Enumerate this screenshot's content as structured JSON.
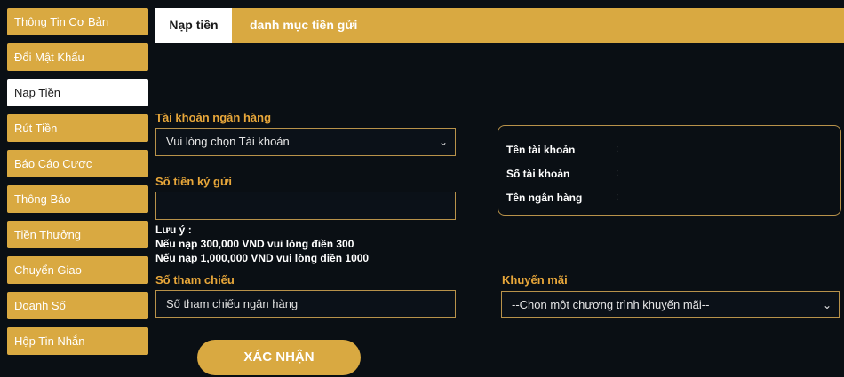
{
  "sidebar": {
    "items": [
      {
        "label": "Thông Tin Cơ Bản"
      },
      {
        "label": "Đổi Mật Khẩu"
      },
      {
        "label": "Nạp Tiền"
      },
      {
        "label": "Rút Tiền"
      },
      {
        "label": "Báo Cáo Cược"
      },
      {
        "label": "Thông Báo"
      },
      {
        "label": "Tiền Thưởng"
      },
      {
        "label": "Chuyển Giao"
      },
      {
        "label": "Doanh Số"
      },
      {
        "label": "Hộp Tin Nhắn"
      }
    ],
    "active_index": 2
  },
  "tabs": [
    {
      "label": "Nạp tiền"
    },
    {
      "label": "danh mục tiền gửi"
    }
  ],
  "form": {
    "bank_account_label": "Tài khoản ngân hàng",
    "bank_account_value": "Vui lòng chọn Tài khoản",
    "deposit_amount_label": "Số tiền ký gửi",
    "deposit_amount_value": "",
    "note_title": "Lưu ý :",
    "note_line1": "Nếu nạp 300,000 VND vui lòng điền 300",
    "note_line2": "Nếu nạp 1,000,000 VND vui lòng điền 1000",
    "reference_label": "Số tham chiếu",
    "reference_placeholder": "Số tham chiếu ngân hàng",
    "promo_label": "Khuyến mãi",
    "promo_value": "--Chọn một chương trình khuyến mãi--",
    "submit_label": "XÁC NHẬN"
  },
  "account_info": {
    "name_label": "Tên tài khoản",
    "number_label": "Số tài khoản",
    "bank_label": "Tên ngân hàng",
    "separator": ":"
  },
  "colors": {
    "accent": "#d9a941",
    "label": "#e8a73a",
    "background": "#0a0f14"
  }
}
